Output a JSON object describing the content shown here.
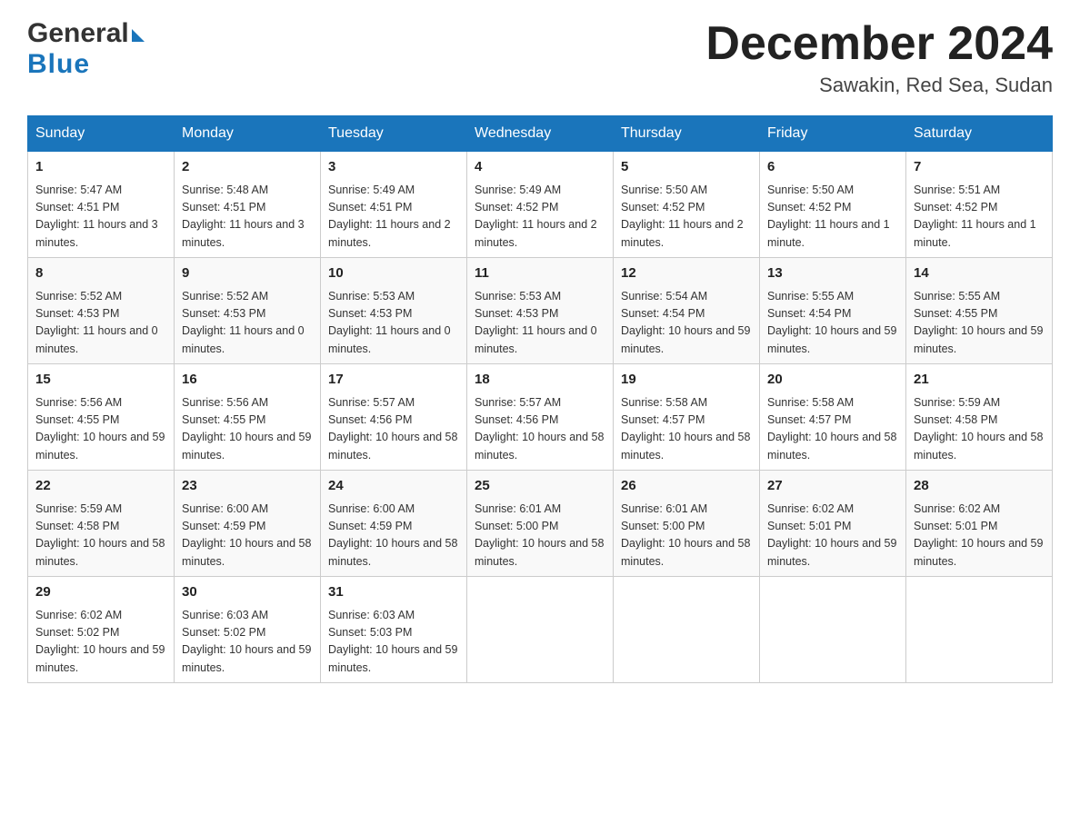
{
  "header": {
    "logo_line1": "General",
    "logo_line2": "Blue",
    "month_title": "December 2024",
    "location": "Sawakin, Red Sea, Sudan"
  },
  "weekdays": [
    "Sunday",
    "Monday",
    "Tuesday",
    "Wednesday",
    "Thursday",
    "Friday",
    "Saturday"
  ],
  "weeks": [
    [
      {
        "day": "1",
        "sunrise": "5:47 AM",
        "sunset": "4:51 PM",
        "daylight": "11 hours and 3 minutes."
      },
      {
        "day": "2",
        "sunrise": "5:48 AM",
        "sunset": "4:51 PM",
        "daylight": "11 hours and 3 minutes."
      },
      {
        "day": "3",
        "sunrise": "5:49 AM",
        "sunset": "4:51 PM",
        "daylight": "11 hours and 2 minutes."
      },
      {
        "day": "4",
        "sunrise": "5:49 AM",
        "sunset": "4:52 PM",
        "daylight": "11 hours and 2 minutes."
      },
      {
        "day": "5",
        "sunrise": "5:50 AM",
        "sunset": "4:52 PM",
        "daylight": "11 hours and 2 minutes."
      },
      {
        "day": "6",
        "sunrise": "5:50 AM",
        "sunset": "4:52 PM",
        "daylight": "11 hours and 1 minute."
      },
      {
        "day": "7",
        "sunrise": "5:51 AM",
        "sunset": "4:52 PM",
        "daylight": "11 hours and 1 minute."
      }
    ],
    [
      {
        "day": "8",
        "sunrise": "5:52 AM",
        "sunset": "4:53 PM",
        "daylight": "11 hours and 0 minutes."
      },
      {
        "day": "9",
        "sunrise": "5:52 AM",
        "sunset": "4:53 PM",
        "daylight": "11 hours and 0 minutes."
      },
      {
        "day": "10",
        "sunrise": "5:53 AM",
        "sunset": "4:53 PM",
        "daylight": "11 hours and 0 minutes."
      },
      {
        "day": "11",
        "sunrise": "5:53 AM",
        "sunset": "4:53 PM",
        "daylight": "11 hours and 0 minutes."
      },
      {
        "day": "12",
        "sunrise": "5:54 AM",
        "sunset": "4:54 PM",
        "daylight": "10 hours and 59 minutes."
      },
      {
        "day": "13",
        "sunrise": "5:55 AM",
        "sunset": "4:54 PM",
        "daylight": "10 hours and 59 minutes."
      },
      {
        "day": "14",
        "sunrise": "5:55 AM",
        "sunset": "4:55 PM",
        "daylight": "10 hours and 59 minutes."
      }
    ],
    [
      {
        "day": "15",
        "sunrise": "5:56 AM",
        "sunset": "4:55 PM",
        "daylight": "10 hours and 59 minutes."
      },
      {
        "day": "16",
        "sunrise": "5:56 AM",
        "sunset": "4:55 PM",
        "daylight": "10 hours and 59 minutes."
      },
      {
        "day": "17",
        "sunrise": "5:57 AM",
        "sunset": "4:56 PM",
        "daylight": "10 hours and 58 minutes."
      },
      {
        "day": "18",
        "sunrise": "5:57 AM",
        "sunset": "4:56 PM",
        "daylight": "10 hours and 58 minutes."
      },
      {
        "day": "19",
        "sunrise": "5:58 AM",
        "sunset": "4:57 PM",
        "daylight": "10 hours and 58 minutes."
      },
      {
        "day": "20",
        "sunrise": "5:58 AM",
        "sunset": "4:57 PM",
        "daylight": "10 hours and 58 minutes."
      },
      {
        "day": "21",
        "sunrise": "5:59 AM",
        "sunset": "4:58 PM",
        "daylight": "10 hours and 58 minutes."
      }
    ],
    [
      {
        "day": "22",
        "sunrise": "5:59 AM",
        "sunset": "4:58 PM",
        "daylight": "10 hours and 58 minutes."
      },
      {
        "day": "23",
        "sunrise": "6:00 AM",
        "sunset": "4:59 PM",
        "daylight": "10 hours and 58 minutes."
      },
      {
        "day": "24",
        "sunrise": "6:00 AM",
        "sunset": "4:59 PM",
        "daylight": "10 hours and 58 minutes."
      },
      {
        "day": "25",
        "sunrise": "6:01 AM",
        "sunset": "5:00 PM",
        "daylight": "10 hours and 58 minutes."
      },
      {
        "day": "26",
        "sunrise": "6:01 AM",
        "sunset": "5:00 PM",
        "daylight": "10 hours and 58 minutes."
      },
      {
        "day": "27",
        "sunrise": "6:02 AM",
        "sunset": "5:01 PM",
        "daylight": "10 hours and 59 minutes."
      },
      {
        "day": "28",
        "sunrise": "6:02 AM",
        "sunset": "5:01 PM",
        "daylight": "10 hours and 59 minutes."
      }
    ],
    [
      {
        "day": "29",
        "sunrise": "6:02 AM",
        "sunset": "5:02 PM",
        "daylight": "10 hours and 59 minutes."
      },
      {
        "day": "30",
        "sunrise": "6:03 AM",
        "sunset": "5:02 PM",
        "daylight": "10 hours and 59 minutes."
      },
      {
        "day": "31",
        "sunrise": "6:03 AM",
        "sunset": "5:03 PM",
        "daylight": "10 hours and 59 minutes."
      },
      null,
      null,
      null,
      null
    ]
  ],
  "labels": {
    "sunrise": "Sunrise:",
    "sunset": "Sunset:",
    "daylight": "Daylight:"
  }
}
